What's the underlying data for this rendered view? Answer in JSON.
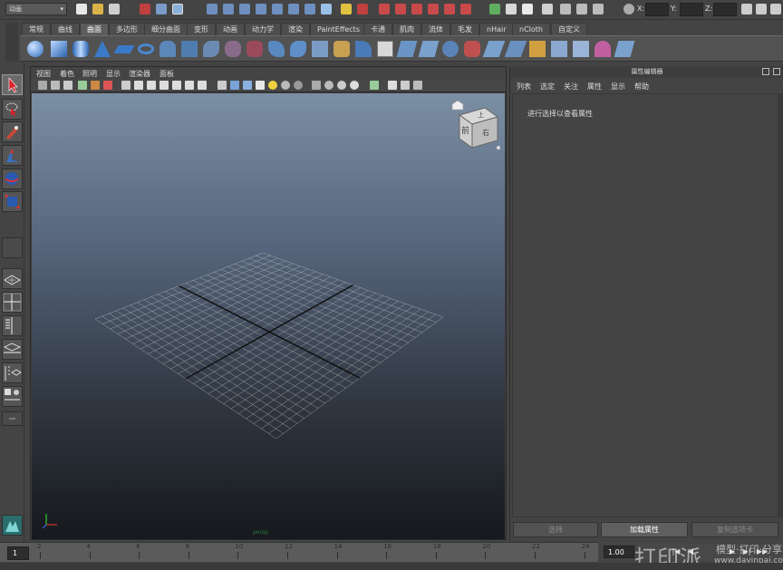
{
  "status_line": {
    "mode": "动画",
    "coords": [
      {
        "label": "X:"
      },
      {
        "label": "Y:"
      },
      {
        "label": "Z:"
      }
    ],
    "icons": [
      "new-scene-icon",
      "open-scene-icon",
      "save-scene-icon",
      "select-hierarchy-icon",
      "select-object-icon",
      "select-component-icon",
      "snap-grid-icon",
      "snap-curve-icon",
      "snap-point-icon",
      "snap-surface-icon",
      "snap-live-icon",
      "history-icon",
      "lock-icon",
      "render-frame-icon",
      "ipr-render-icon",
      "render-settings-icon",
      "hypershade-icon",
      "render-view-icon"
    ]
  },
  "shelf": {
    "tabs": [
      "常规",
      "曲线",
      "曲面",
      "多边形",
      "细分曲面",
      "变形",
      "动画",
      "动力学",
      "渲染",
      "PaintEffects",
      "卡通",
      "肌肉",
      "流体",
      "毛发",
      "nHair",
      "nCloth",
      "自定义"
    ],
    "active_tab": "曲面",
    "icons": [
      "sphere-icon",
      "cube-icon",
      "cylinder-icon",
      "cone-icon",
      "plane-icon",
      "torus-icon",
      "revolve-icon",
      "loft-icon",
      "planar-icon",
      "extrude-icon",
      "birail-icon",
      "boundary-icon",
      "square-icon",
      "bevel-icon",
      "intersect-icon",
      "project-curve-icon",
      "trim-icon",
      "untrim-icon",
      "attach-icon",
      "detach-icon",
      "align-icon",
      "open-close-icon",
      "insert-isoparm-icon",
      "extend-icon",
      "offset-icon",
      "rebuild-icon",
      "reverse-icon",
      "sculpt-icon"
    ]
  },
  "toolbox": {
    "tools": [
      "select-tool-icon",
      "lasso-tool-icon",
      "paint-select-icon",
      "move-tool-icon",
      "rotate-tool-icon",
      "scale-tool-icon",
      "last-tool-icon",
      "single-view-layout-icon",
      "four-view-layout-icon",
      "side-by-side-layout-icon",
      "persp-graph-layout-icon",
      "persp-outliner-layout-icon",
      "hypershade-layout-icon"
    ]
  },
  "viewport": {
    "menus": [
      "视图",
      "着色",
      "照明",
      "显示",
      "渲染器",
      "面板"
    ],
    "camera_label": "persp",
    "cube_face_front": "前",
    "cube_face_top": "上",
    "cube_face_right": "右",
    "grid_color": "#bcbcbc",
    "axis_line_color": "#111111"
  },
  "attribute_editor": {
    "title": "属性编辑器",
    "menus": [
      "列表",
      "选定",
      "关注",
      "属性",
      "显示",
      "帮助"
    ],
    "hint": "进行选择以查看属性",
    "buttons": {
      "select": "选择",
      "load": "加载属性",
      "copy_tab": "复制选项卡"
    }
  },
  "time_slider": {
    "current_frame": "1",
    "ticks": [
      "2",
      "4",
      "6",
      "8",
      "10",
      "12",
      "14",
      "16",
      "18",
      "20",
      "22",
      "24"
    ],
    "time_value": "1.00"
  },
  "watermark": {
    "text": "打印派",
    "sub": "模型·打印·分享",
    "url": "www.dayinpai.com"
  }
}
